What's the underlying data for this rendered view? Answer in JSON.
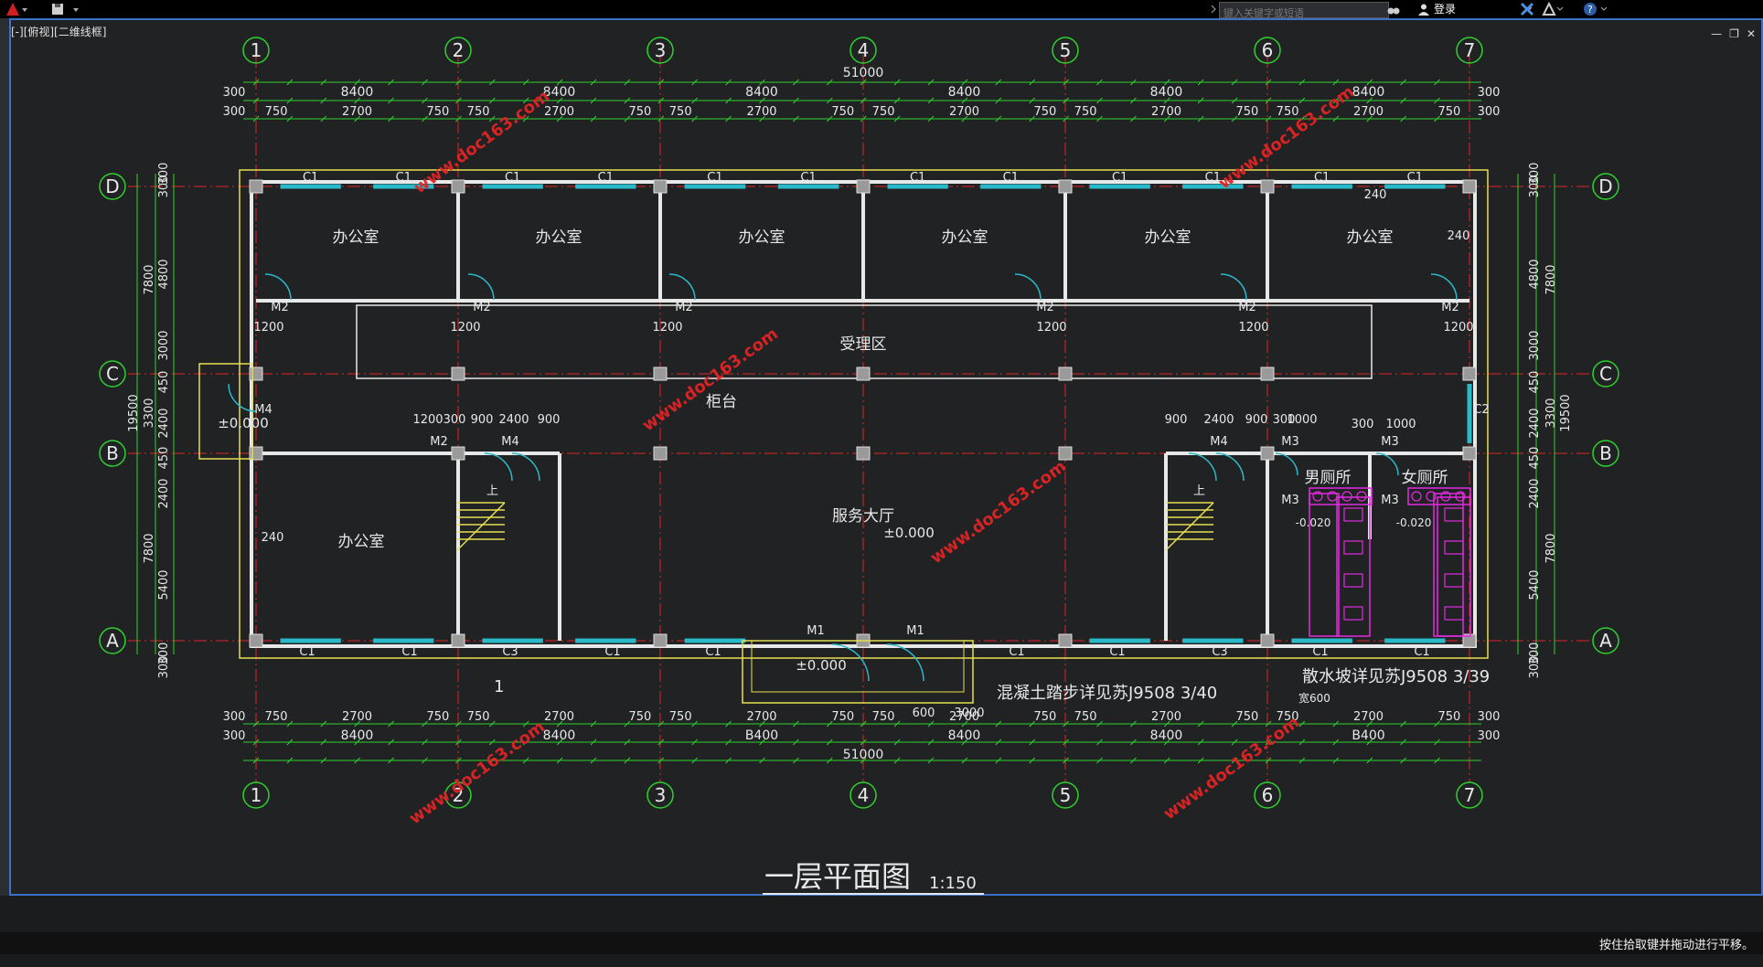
{
  "view_label": "[-][俯视][二维线框]",
  "search_placeholder": "键入关键字或短语",
  "login_label": "登录",
  "status_text": "按住拾取键并拖动进行平移。",
  "drawing": {
    "title": "一层平面图",
    "scale": "1:150",
    "axes_x": [
      "1",
      "2",
      "3",
      "4",
      "5",
      "6",
      "7"
    ],
    "axes_y": [
      "D",
      "C",
      "B",
      "A"
    ],
    "total_width": "51000",
    "bay": "8400",
    "bay_bottom_3": "B400",
    "bay_bottom_6": "B400",
    "subdims_top": [
      "750",
      "2700",
      "750",
      "750",
      "2700",
      "750",
      "750",
      "2700",
      "750",
      "750",
      "2700",
      "750",
      "750",
      "2700",
      "750",
      "750",
      "2700",
      "750"
    ],
    "offset": "300",
    "rooms": {
      "office": "办公室",
      "reception": "受理区",
      "counter": "柜台",
      "hall": "服务大厅",
      "male_wc": "男厕所",
      "female_wc": "女厕所"
    },
    "levels": {
      "zero": "±0.000",
      "wc": "-0.020"
    },
    "notes": {
      "steps": "混凝土踏步详见苏J9508 3/40",
      "ramp": "散水坡详见苏J9508 3/39",
      "ramp_width": "宽600",
      "up": "上"
    },
    "tags": {
      "c1": "C1",
      "c2": "C2",
      "c3": "C3",
      "m1": "M1",
      "m2": "M2",
      "m3": "M3",
      "m4": "M4"
    },
    "dims_left": [
      "300",
      "300",
      "4800",
      "3000",
      "450",
      "2400",
      "450",
      "2400",
      "5400",
      "300",
      "300"
    ],
    "dims_left_outer": [
      "7800",
      "3300",
      "7800"
    ],
    "dims_total_h": "19500",
    "dims_misc": [
      "1200",
      "300",
      "900",
      "2400",
      "240",
      "1000",
      "600",
      "3000"
    ],
    "watermark": "www.doc163.com",
    "section_mark": "1"
  }
}
